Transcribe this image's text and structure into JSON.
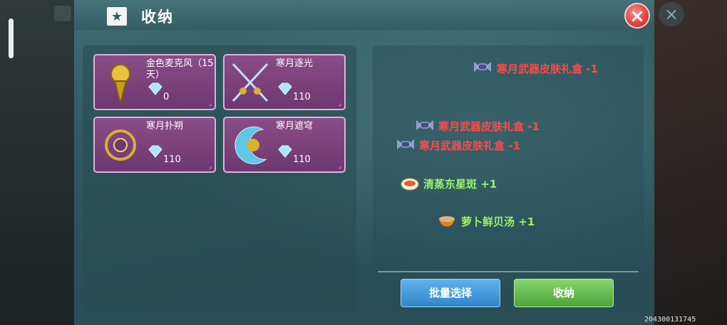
{
  "dialog": {
    "title": "收纳",
    "close_icon": "close-icon",
    "title_icon": "star-box-icon"
  },
  "items": [
    {
      "name": "金色麦克风（15天）",
      "cost": "0",
      "icon": "golden-microphone-icon"
    },
    {
      "name": "寒月逐光",
      "cost": "110",
      "icon": "crossed-swords-icon"
    },
    {
      "name": "寒月扑朔",
      "cost": "110",
      "icon": "ornate-ring-icon"
    },
    {
      "name": "寒月遮穹",
      "cost": "110",
      "icon": "crescent-blade-icon"
    }
  ],
  "log": [
    {
      "text": "寒月武器皮肤礼盒 -1",
      "color": "#ff4a4a",
      "icon": "candy-gift-icon"
    },
    {
      "text": "寒月武器皮肤礼盒 -1",
      "color": "#ff4a4a",
      "icon": "candy-gift-icon"
    },
    {
      "text": "寒月武器皮肤礼盒 -1",
      "color": "#ff4a4a",
      "icon": "candy-gift-icon"
    },
    {
      "text": "清蒸东星斑 +1",
      "color": "#9af26a",
      "icon": "steamed-fish-icon"
    },
    {
      "text": "萝卜鲜贝汤 +1",
      "color": "#9af26a",
      "icon": "soup-bowl-icon"
    }
  ],
  "buttons": {
    "batch_select": "批量选择",
    "store": "收纳"
  },
  "uid": "204300131745"
}
